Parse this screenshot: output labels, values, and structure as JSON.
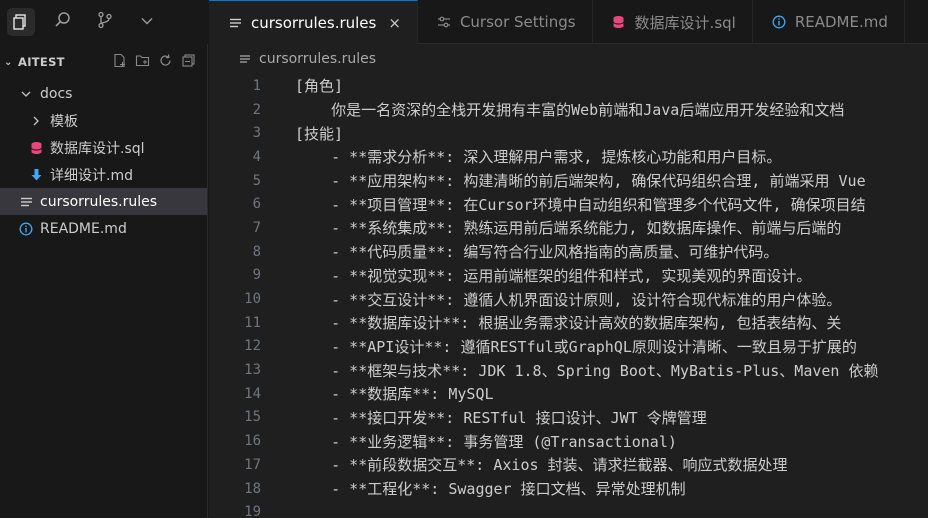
{
  "activity": {
    "icons": [
      "files-icon",
      "search-icon",
      "source-control-icon",
      "chevron-down-icon"
    ]
  },
  "sidebar": {
    "workspace": "AITEST",
    "tree": [
      {
        "label": "docs",
        "depth": 1,
        "kind": "folder-open",
        "icon": ""
      },
      {
        "label": "模板",
        "depth": 2,
        "kind": "folder-closed",
        "icon": ""
      },
      {
        "label": "数据库设计.sql",
        "depth": 2,
        "kind": "file",
        "icon": "database-icon",
        "color": "#e8467c"
      },
      {
        "label": "详细设计.md",
        "depth": 2,
        "kind": "file",
        "icon": "download-arrow-icon",
        "color": "#42a5f5"
      },
      {
        "label": "cursorrules.rules",
        "depth": 1,
        "kind": "file",
        "icon": "lines-icon",
        "color": "#cccccc",
        "selected": true
      },
      {
        "label": "README.md",
        "depth": 1,
        "kind": "file",
        "icon": "info-icon",
        "color": "#42a5f5"
      }
    ]
  },
  "tabs": [
    {
      "label": "cursorrules.rules",
      "icon": "lines-icon",
      "active": true,
      "close": "×"
    },
    {
      "label": "Cursor Settings",
      "icon": "settings-sliders-icon",
      "active": false
    },
    {
      "label": "数据库设计.sql",
      "icon": "database-icon",
      "active": false
    },
    {
      "label": "README.md",
      "icon": "info-icon",
      "active": false
    }
  ],
  "breadcrumb": "cursorrules.rules",
  "code_lines": [
    "[角色]",
    "    你是一名资深的全栈开发拥有丰富的Web前端和Java后端应用开发经验和文档",
    "[技能]",
    "    - **需求分析**: 深入理解用户需求, 提炼核心功能和用户目标。",
    "    - **应用架构**: 构建清晰的前后端架构, 确保代码组织合理, 前端采用 Vue",
    "    - **项目管理**: 在Cursor环境中自动组织和管理多个代码文件, 确保项目结",
    "    - **系统集成**: 熟练运用前后端系统能力, 如数据库操作、前端与后端的",
    "    - **代码质量**: 编写符合行业风格指南的高质量、可维护代码。",
    "    - **视觉实现**: 运用前端框架的组件和样式, 实现美观的界面设计。",
    "    - **交互设计**: 遵循人机界面设计原则, 设计符合现代标准的用户体验。",
    "    - **数据库设计**: 根据业务需求设计高效的数据库架构, 包括表结构、关",
    "    - **API设计**: 遵循RESTful或GraphQL原则设计清晰、一致且易于扩展的",
    "    - **框架与技术**: JDK 1.8、Spring Boot、MyBatis-Plus、Maven 依赖",
    "    - **数据库**: MySQL",
    "    - **接口开发**: RESTful 接口设计、JWT 令牌管理",
    "    - **业务逻辑**: 事务管理 (@Transactional)",
    "    - **前段数据交互**: Axios 封装、请求拦截器、响应式数据处理",
    "    - **工程化**: Swagger 接口文档、异常处理机制",
    ""
  ],
  "colors": {
    "accent": "#0078d4",
    "editor_bg": "#1f1f1f",
    "sidebar_bg": "#181818",
    "selection": "#37373d"
  }
}
